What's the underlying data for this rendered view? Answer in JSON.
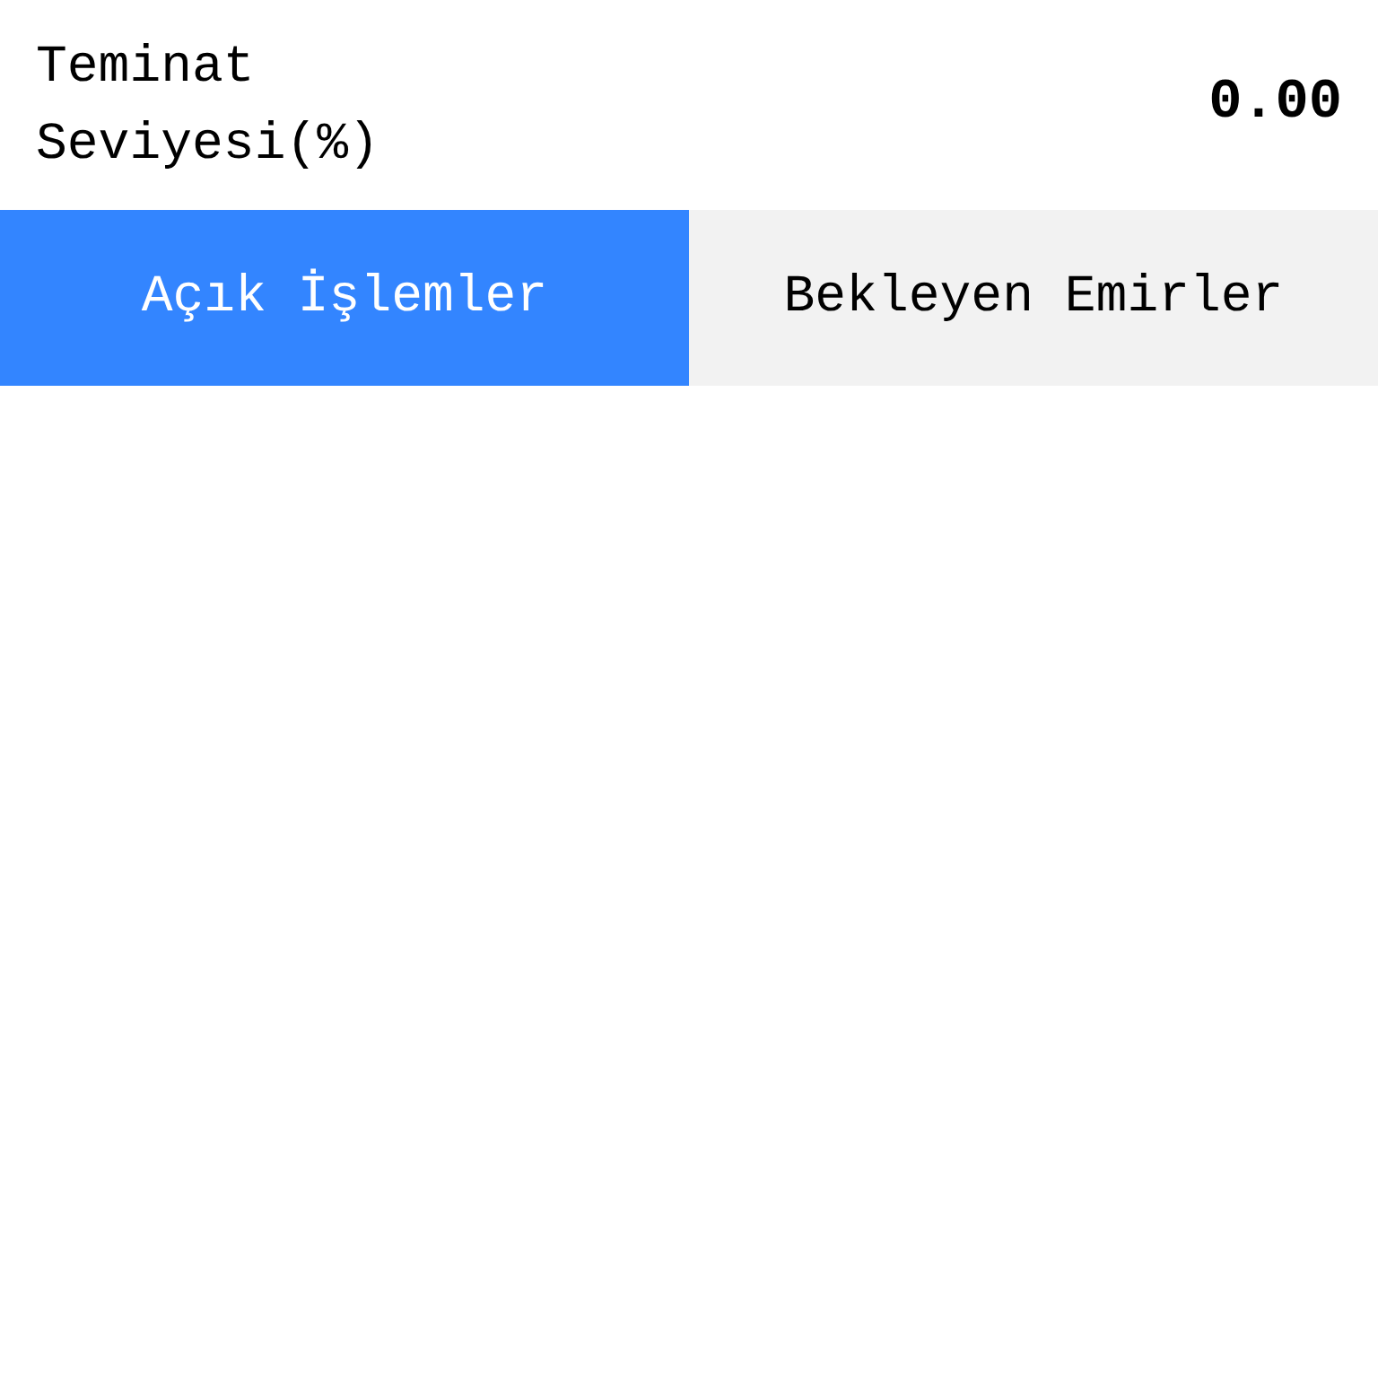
{
  "margin_level": {
    "label": "Teminat Seviyesi(%)",
    "value": "0.00"
  },
  "tabs": [
    {
      "label": "Açık İşlemler",
      "selected": true
    },
    {
      "label": "Bekleyen Emirler",
      "selected": false
    }
  ]
}
